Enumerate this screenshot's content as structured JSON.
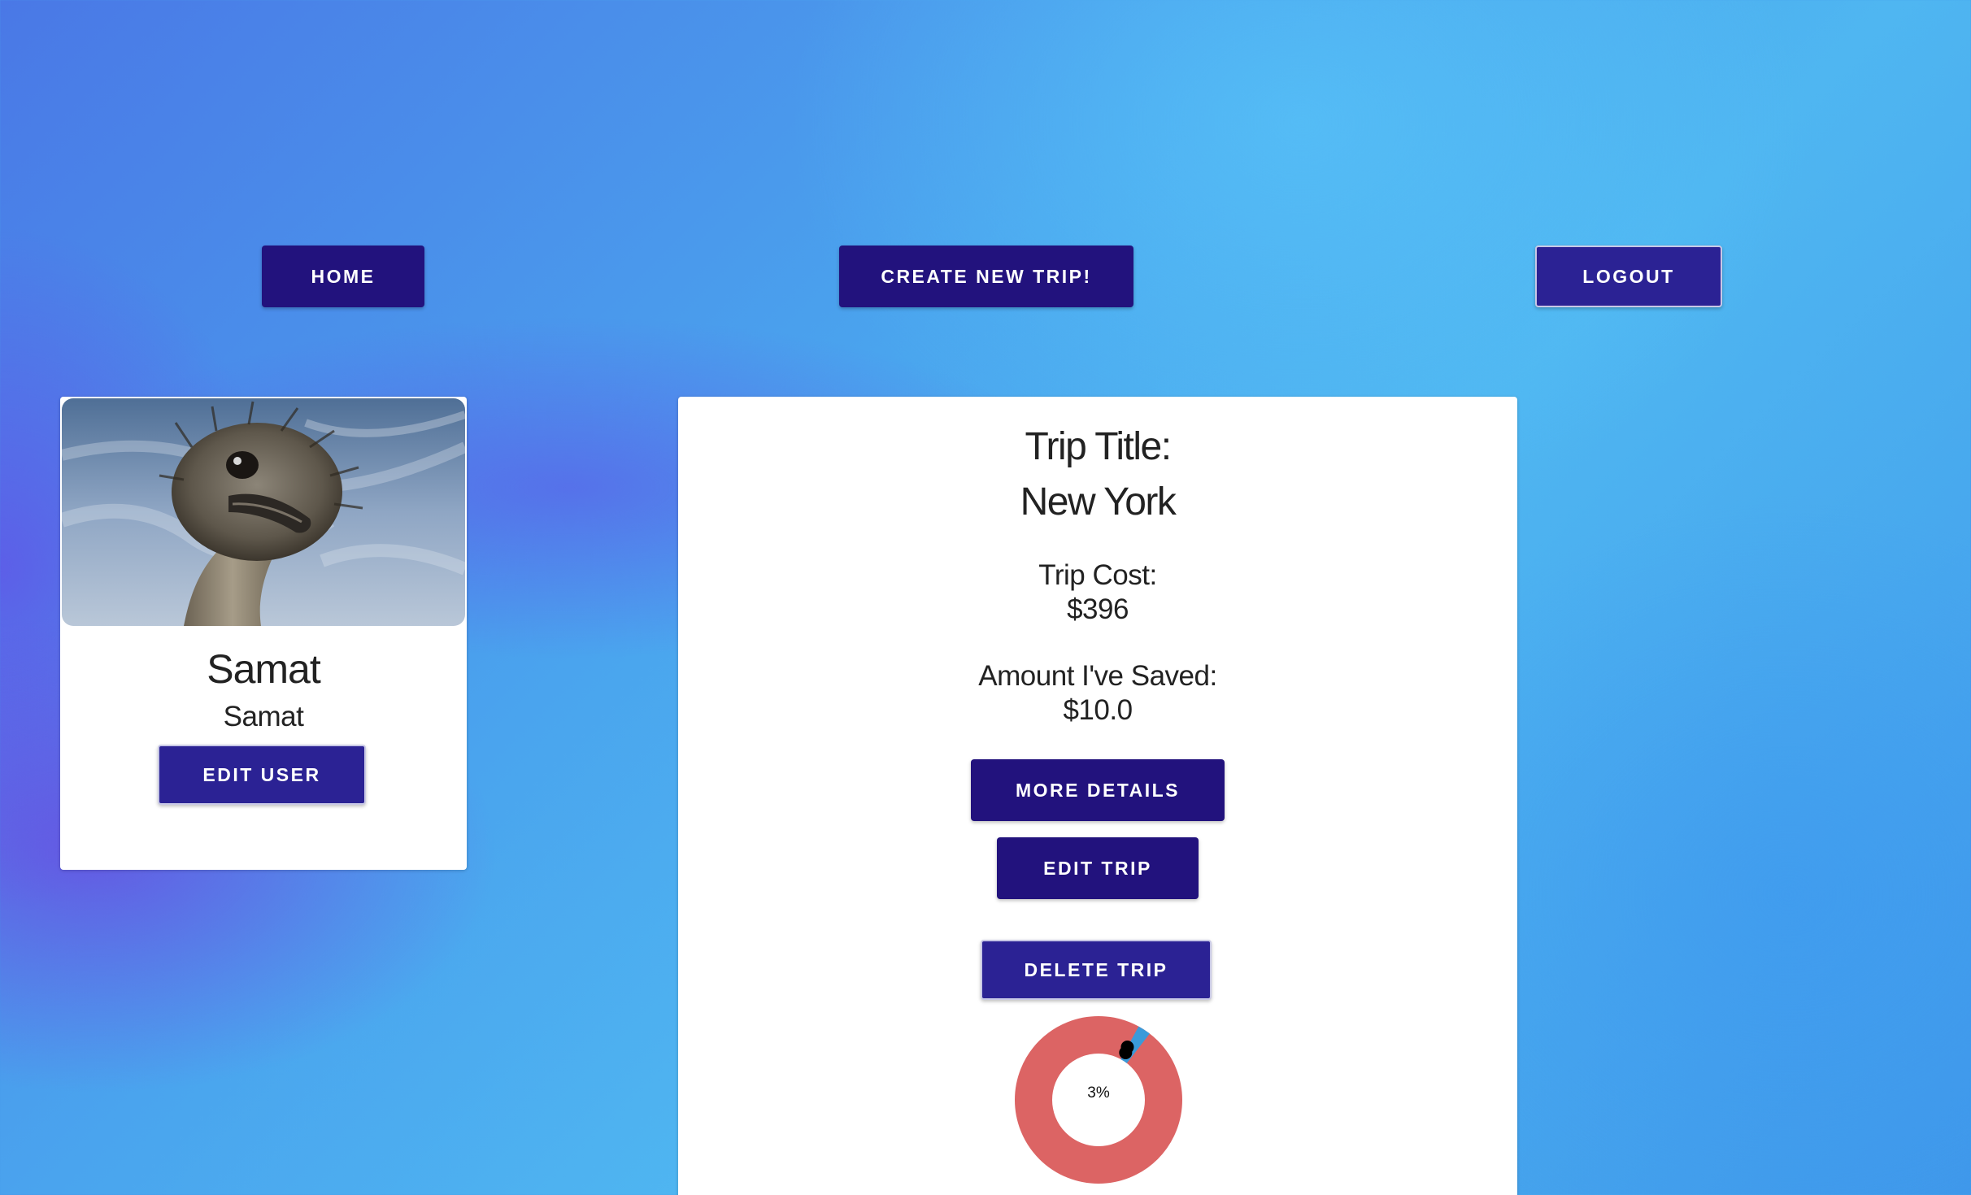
{
  "nav": {
    "home_label": "HOME",
    "create_label": "CREATE NEW TRIP!",
    "logout_label": "LOGOUT"
  },
  "user": {
    "name": "Samat",
    "username": "Samat",
    "edit_label": "EDIT USER"
  },
  "trip": {
    "title_label": "Trip Title:",
    "title_value": "New York",
    "cost_label": "Trip Cost:",
    "cost_value": "$396",
    "saved_label": "Amount I've Saved:",
    "saved_value": "$10.0",
    "more_details_label": "MORE DETAILS",
    "edit_label": "EDIT TRIP",
    "delete_label": "DELETE TRIP"
  },
  "progress": {
    "percent_label": "3%",
    "saved_fraction": 0.025,
    "colors": {
      "remaining": "#dc6464",
      "saved": "#3a9ad9",
      "handle": "#000000"
    }
  },
  "colors": {
    "button_primary": "#22127d",
    "button_secondary": "#2b2294",
    "card": "#ffffff"
  }
}
